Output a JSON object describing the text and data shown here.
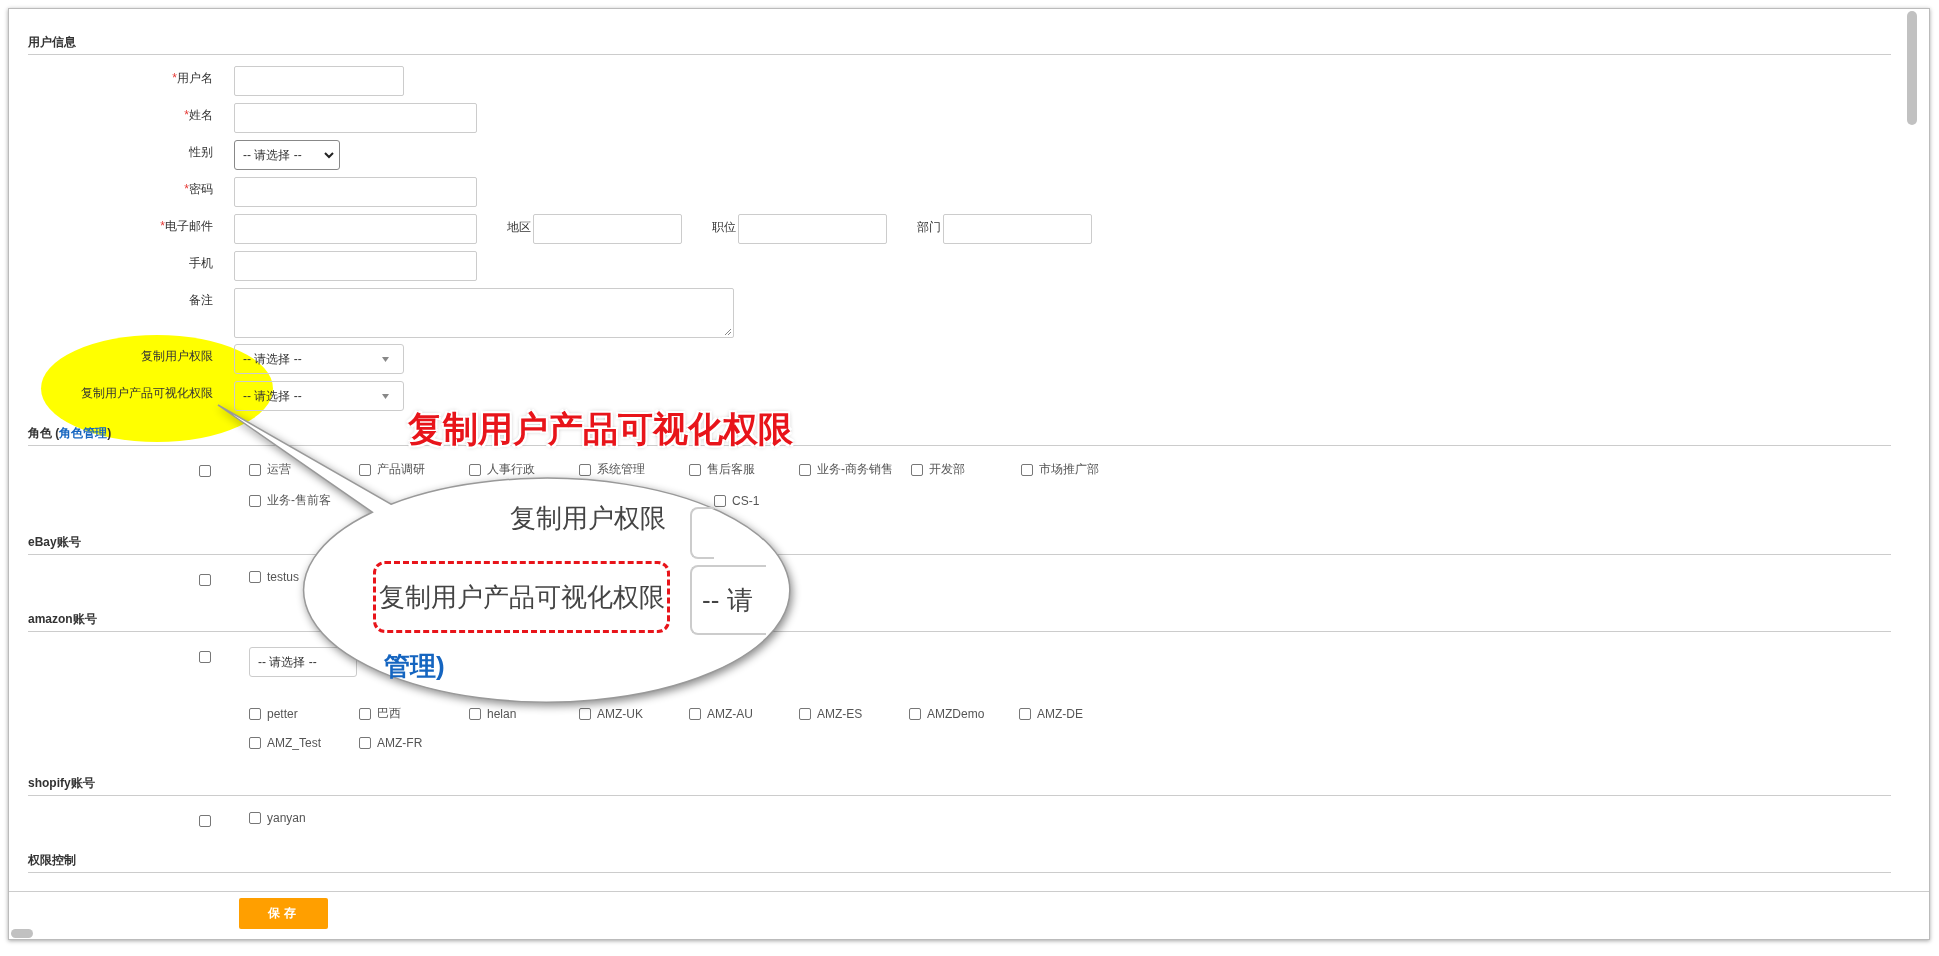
{
  "user_info": {
    "title": "用户信息",
    "fields": [
      {
        "label": "用户名",
        "marker": "*",
        "kind": "short-text"
      },
      {
        "label": "姓名",
        "marker": "*",
        "kind": "text"
      },
      {
        "label": "性别",
        "kind": "native-select",
        "value": "-- 请选择 --"
      },
      {
        "label": "密码",
        "marker": "*",
        "kind": "text"
      },
      {
        "label": "电子邮件",
        "marker": "*",
        "kind": "text",
        "extras": [
          {
            "label": "地区"
          },
          {
            "label": "职位"
          },
          {
            "label": "部门"
          }
        ]
      },
      {
        "label": "手机",
        "kind": "text"
      },
      {
        "label": "备注",
        "kind": "textarea"
      },
      {
        "label": "复制用户权限",
        "kind": "dropdown",
        "value": "-- 请选择 --"
      },
      {
        "label": "复制用户产品可视化权限",
        "kind": "dropdown",
        "value": "-- 请选择 --"
      }
    ]
  },
  "sections": [
    {
      "title": "角色 (",
      "link": "角色管理",
      "title_end": ")",
      "all_checked": false,
      "lines": [
        [
          {
            "label": "运营",
            "checked": false
          },
          {
            "label": "产品调研",
            "checked": false
          },
          {
            "label": "人事行政",
            "checked": false
          },
          {
            "label": "系统管理",
            "checked": false
          },
          {
            "label": "售后客服",
            "checked": false
          },
          {
            "label": "业务-商务销售",
            "checked": false
          },
          {
            "label": "开发部",
            "checked": false
          },
          {
            "label": "市场推广部",
            "checked": false
          }
        ],
        [
          {
            "label": "业务-售前客",
            "checked": false
          },
          {
            "label": "CS-1",
            "checked": false,
            "covered_before": true
          }
        ]
      ]
    },
    {
      "title": "eBay账号",
      "all_checked": false,
      "lines": [
        [
          {
            "label": "testus",
            "checked": false
          }
        ]
      ]
    },
    {
      "title": "amazon账号",
      "select": {
        "value": "-- 请选择 --"
      },
      "all_checked": false,
      "lines": [
        [
          {
            "label": "petter",
            "checked": false
          },
          {
            "label": "巴西",
            "checked": false
          },
          {
            "label": "helan",
            "checked": false
          },
          {
            "label": "AMZ-UK",
            "checked": false
          },
          {
            "label": "AMZ-AU",
            "checked": false
          },
          {
            "label": "AMZ-ES",
            "checked": false
          },
          {
            "label": "AMZDemo",
            "checked": false
          },
          {
            "label": "AMZ-DE",
            "checked": false
          }
        ],
        [
          {
            "label": "AMZ_Test",
            "checked": false
          },
          {
            "label": "AMZ-FR",
            "checked": false
          }
        ]
      ]
    },
    {
      "title": "shopify账号",
      "all_checked": false,
      "lines": [
        [
          {
            "label": "yanyan",
            "checked": false
          }
        ]
      ]
    },
    {
      "title": "权限控制"
    }
  ],
  "save_button": "保存",
  "annotation": {
    "caption": "复制用户产品可视化权限",
    "magnifier": {
      "label_1": "复制用户权限",
      "label_2": "复制用户产品可视化权限",
      "select_2": "-- 请",
      "link": "管理)"
    }
  }
}
